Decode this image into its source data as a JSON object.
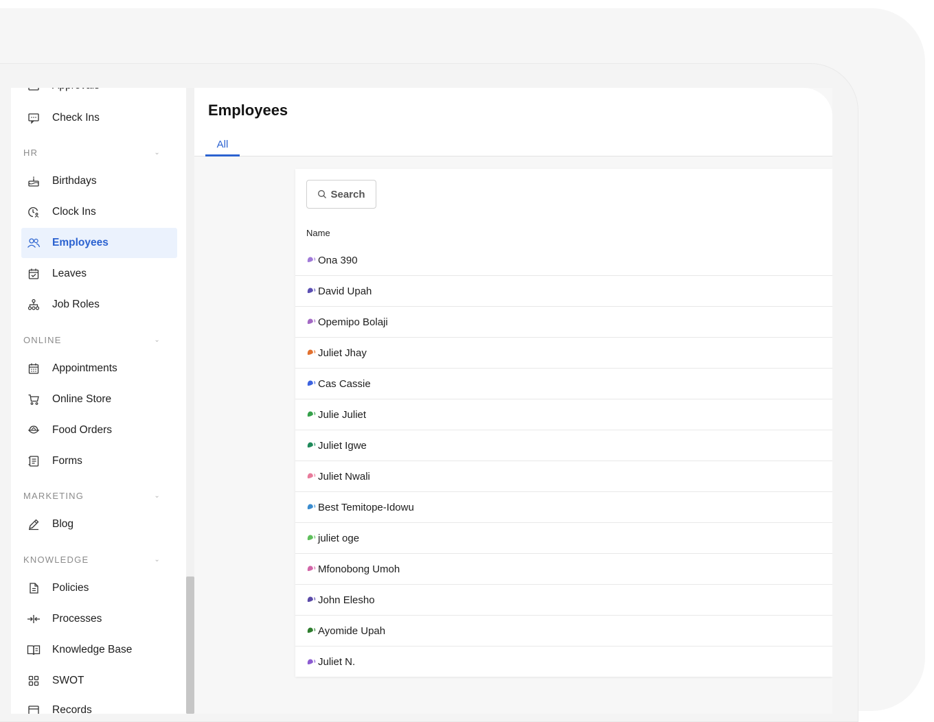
{
  "sidebar": {
    "cut_top_label": "Approvals",
    "cut_bottom_label": "Records",
    "top_items": [
      {
        "label": "Check Ins",
        "icon": "chat-icon"
      }
    ],
    "sections": [
      {
        "title": "HR",
        "items": [
          {
            "label": "Birthdays",
            "icon": "cake-icon"
          },
          {
            "label": "Clock Ins",
            "icon": "clock-user-icon"
          },
          {
            "label": "Employees",
            "icon": "users-icon",
            "active": true
          },
          {
            "label": "Leaves",
            "icon": "calendar-check-icon"
          },
          {
            "label": "Job Roles",
            "icon": "org-chart-icon"
          }
        ]
      },
      {
        "title": "ONLINE",
        "items": [
          {
            "label": "Appointments",
            "icon": "calendar-grid-icon"
          },
          {
            "label": "Online Store",
            "icon": "cart-icon"
          },
          {
            "label": "Food Orders",
            "icon": "bowl-icon"
          },
          {
            "label": "Forms",
            "icon": "form-icon"
          }
        ]
      },
      {
        "title": "MARKETING",
        "items": [
          {
            "label": "Blog",
            "icon": "pen-icon"
          }
        ]
      },
      {
        "title": "KNOWLEDGE",
        "items": [
          {
            "label": "Policies",
            "icon": "document-icon"
          },
          {
            "label": "Processes",
            "icon": "processes-icon"
          },
          {
            "label": "Knowledge Base",
            "icon": "book-icon"
          },
          {
            "label": "SWOT",
            "icon": "grid-icon"
          }
        ]
      }
    ]
  },
  "main": {
    "title": "Employees",
    "tabs": [
      {
        "label": "All",
        "active": true
      }
    ],
    "search_label": "Search",
    "column_header": "Name",
    "employees": [
      {
        "name": "Ona 390",
        "color": "#a07ad8"
      },
      {
        "name": "David Upah",
        "color": "#5b4fb3"
      },
      {
        "name": "Opemipo Bolaji",
        "color": "#a369c4"
      },
      {
        "name": "Juliet Jhay",
        "color": "#e2712f"
      },
      {
        "name": "Cas Cassie",
        "color": "#3d63e0"
      },
      {
        "name": "Julie Juliet",
        "color": "#35a04a"
      },
      {
        "name": "Juliet Igwe",
        "color": "#1f8a5a"
      },
      {
        "name": "Juliet Nwali",
        "color": "#e87b9b"
      },
      {
        "name": "Best Temitope-Idowu",
        "color": "#3a8ccf"
      },
      {
        "name": "juliet oge",
        "color": "#5fbf5c"
      },
      {
        "name": "Mfonobong Umoh",
        "color": "#d266a8"
      },
      {
        "name": "John Elesho",
        "color": "#5a4aa8"
      },
      {
        "name": "Ayomide Upah",
        "color": "#2e7d2e"
      },
      {
        "name": "Juliet N.",
        "color": "#8c5cd1"
      }
    ]
  },
  "colors": {
    "accent": "#2b62d0",
    "active_bg": "#ebf2fd"
  }
}
